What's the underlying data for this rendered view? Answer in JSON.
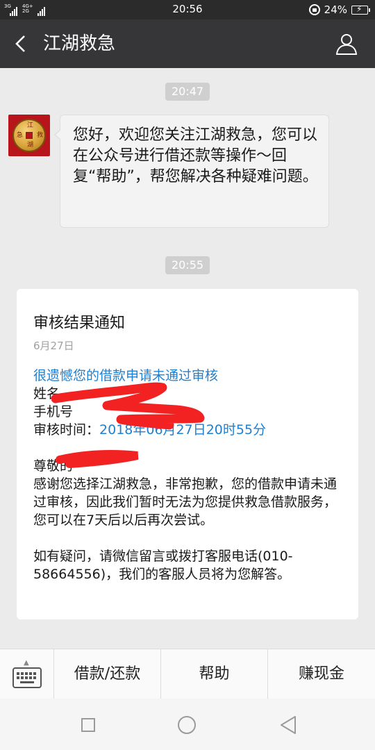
{
  "status_bar": {
    "sim1": "3G",
    "sim2": "4G+ 2G",
    "time": "20:56",
    "battery": "24%"
  },
  "header": {
    "title": "江湖救急"
  },
  "chat": {
    "timestamps": [
      "20:47",
      "20:55"
    ],
    "welcome_message": "您好，欢迎您关注江湖救急，您可以在公众号进行借还款等操作～回复“帮助”，帮您解决各种疑难问题。",
    "avatar_chars": [
      "江",
      "湖",
      "救",
      "急"
    ]
  },
  "card": {
    "title": "审核结果通知",
    "date": "6月27日",
    "headline": "很遗憾您的借款申请未通过审核",
    "name_label": "姓名",
    "phone_label": "手机号",
    "review_time_label": "审核时间：",
    "review_time_value": "2018年06月27日20时55分",
    "greeting_prefix": "尊敬的",
    "paragraph1": "感谢您选择江湖救急，非常抱歉，您的借款申请未通过审核，因此我们暂时无法为您提供救急借款服务，您可以在7天后以后再次尝试。",
    "paragraph2": "如有疑问，请微信留言或拨打客服电话(010-58664556)，我们的客服人员将为您解答。"
  },
  "menu": {
    "items": [
      "借款/还款",
      "帮助",
      "赚现金"
    ]
  },
  "colors": {
    "header_bg": "#363638",
    "link_blue": "#1f7fd1",
    "redaction": "#f22222"
  }
}
